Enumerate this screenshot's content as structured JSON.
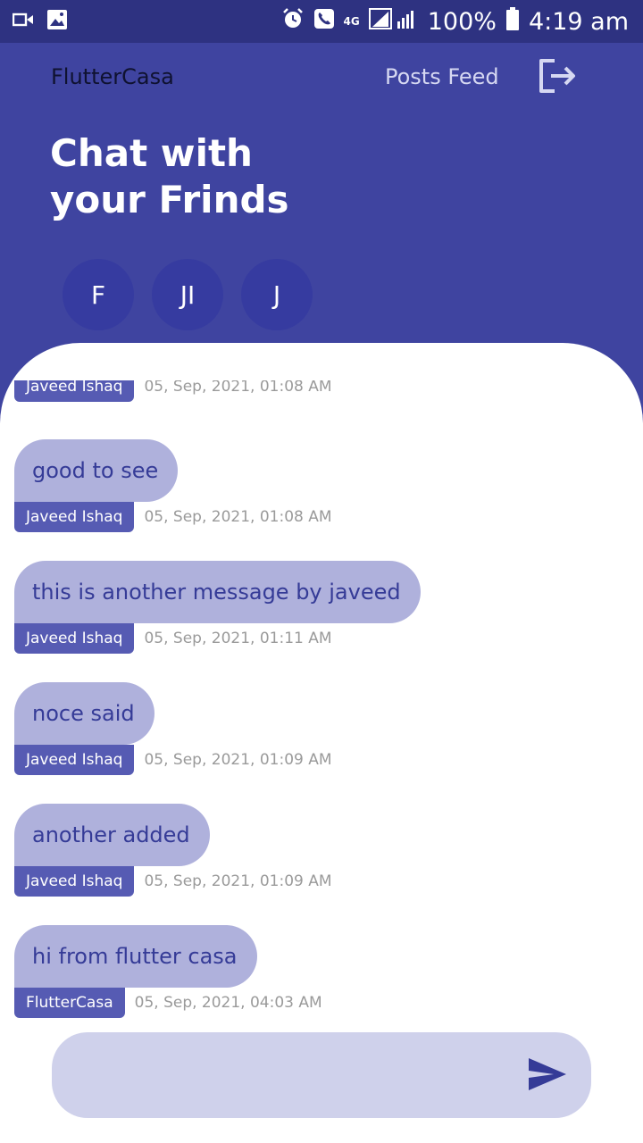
{
  "status_bar": {
    "network": "4G",
    "battery_percent": "100%",
    "time": "4:19 am",
    "icons": [
      "video-icon",
      "image-icon",
      "alarm-icon",
      "phone-icon",
      "signal-icon",
      "battery-icon"
    ]
  },
  "header": {
    "brand": "FlutterCasa",
    "posts_link": "Posts Feed",
    "logout_icon": "logout-icon",
    "title_line1": "Chat with",
    "title_line2": "your Frinds",
    "avatars": [
      "F",
      "JI",
      "J"
    ]
  },
  "messages": [
    {
      "text": "",
      "sender": "Javeed Ishaq",
      "time": "05, Sep, 2021, 01:08 AM"
    },
    {
      "text": "good to see",
      "sender": "Javeed Ishaq",
      "time": "05, Sep, 2021, 01:08 AM"
    },
    {
      "text": "this is another message by javeed",
      "sender": "Javeed Ishaq",
      "time": "05, Sep, 2021, 01:11 AM"
    },
    {
      "text": "noce said",
      "sender": "Javeed Ishaq",
      "time": "05, Sep, 2021, 01:09 AM"
    },
    {
      "text": "another added",
      "sender": "Javeed Ishaq",
      "time": "05, Sep, 2021, 01:09 AM"
    },
    {
      "text": "hi from flutter casa",
      "sender": "FlutterCasa",
      "time": "05, Sep, 2021, 04:03 AM"
    }
  ],
  "composer": {
    "value": "",
    "placeholder": "",
    "send_icon": "send-icon"
  },
  "colors": {
    "primary": "#3f44a0",
    "status_bar": "#2e3281",
    "bubble": "#afb1dc",
    "bubble_text": "#353b97",
    "sender_badge": "#565bb3",
    "composer_bg": "#cfd1eb"
  }
}
